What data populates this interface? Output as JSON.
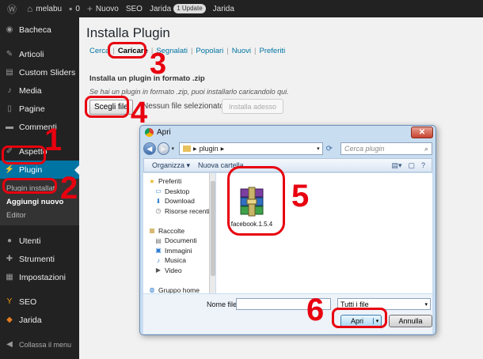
{
  "topbar": {
    "site_name": "melabu",
    "comments_count": "0",
    "new_label": "Nuovo",
    "seo_label": "SEO",
    "jarida_label": "Jarida",
    "update_badge": "1 Update",
    "jarida2_label": "Jarida"
  },
  "sidebar": {
    "items": [
      {
        "label": "Bacheca",
        "icon": "dashboard-icon"
      },
      {
        "label": "Articoli",
        "icon": "pin-icon"
      },
      {
        "label": "Custom Sliders",
        "icon": "slider-icon"
      },
      {
        "label": "Media",
        "icon": "media-icon"
      },
      {
        "label": "Pagine",
        "icon": "page-icon"
      },
      {
        "label": "Commenti",
        "icon": "comment-icon"
      },
      {
        "label": "Aspetto",
        "icon": "brush-icon"
      },
      {
        "label": "Plugin",
        "icon": "plugin-icon"
      },
      {
        "label": "Utenti",
        "icon": "users-icon"
      },
      {
        "label": "Strumenti",
        "icon": "wrench-icon"
      },
      {
        "label": "Impostazioni",
        "icon": "settings-icon"
      },
      {
        "label": "SEO",
        "icon": "seo-icon"
      },
      {
        "label": "Jarida",
        "icon": "theme-icon"
      }
    ],
    "submenu": [
      "Plugin installati",
      "Aggiungi nuovo",
      "Editor"
    ],
    "collapse_label": "Collassa il menu"
  },
  "main": {
    "title": "Installa Plugin",
    "tabs": [
      "Cerca",
      "Caricare",
      "Segnalati",
      "Popolari",
      "Nuovi",
      "Preferiti"
    ],
    "upload_heading": "Installa un plugin in formato .zip",
    "upload_desc": "Se hai un plugin in formato .zip, puoi installarlo caricandolo qui.",
    "choose_button": "Scegli file",
    "no_file": "Nessun file selezionato",
    "install_button": "Installa adesso"
  },
  "dialog": {
    "title": "Apri",
    "close": "✕",
    "path_root": "▶",
    "path_folder": "plugin",
    "search_placeholder": "Cerca plugin",
    "organize": "Organizza ▾",
    "new_folder": "Nuova cartella",
    "nav_items": [
      {
        "label": "Preferiti",
        "icon": "star-icon",
        "indent": 0
      },
      {
        "label": "Desktop",
        "icon": "desktop-icon",
        "indent": 1
      },
      {
        "label": "Download",
        "icon": "download-icon",
        "indent": 1
      },
      {
        "label": "Risorse recenti",
        "icon": "recent-icon",
        "indent": 1
      },
      {
        "label": "",
        "icon": "",
        "indent": 0
      },
      {
        "label": "Raccolte",
        "icon": "library-icon",
        "indent": 0
      },
      {
        "label": "Documenti",
        "icon": "documents-icon",
        "indent": 1
      },
      {
        "label": "Immagini",
        "icon": "pictures-icon",
        "indent": 1
      },
      {
        "label": "Musica",
        "icon": "music-icon",
        "indent": 1
      },
      {
        "label": "Video",
        "icon": "video-icon",
        "indent": 1
      },
      {
        "label": "",
        "icon": "",
        "indent": 0
      },
      {
        "label": "Gruppo home",
        "icon": "homegroup-icon",
        "indent": 0
      }
    ],
    "file_name": "facebook.1.5.4",
    "filename_label": "Nome file:",
    "filetype": "Tutti i file",
    "open_button": "Apri",
    "cancel_button": "Annulla"
  },
  "annotations": [
    "1",
    "2",
    "3",
    "4",
    "5",
    "6"
  ],
  "colors": {
    "annotation_red": "#e8000f",
    "wp_blue": "#0074a2",
    "admin_dark": "#222222"
  }
}
